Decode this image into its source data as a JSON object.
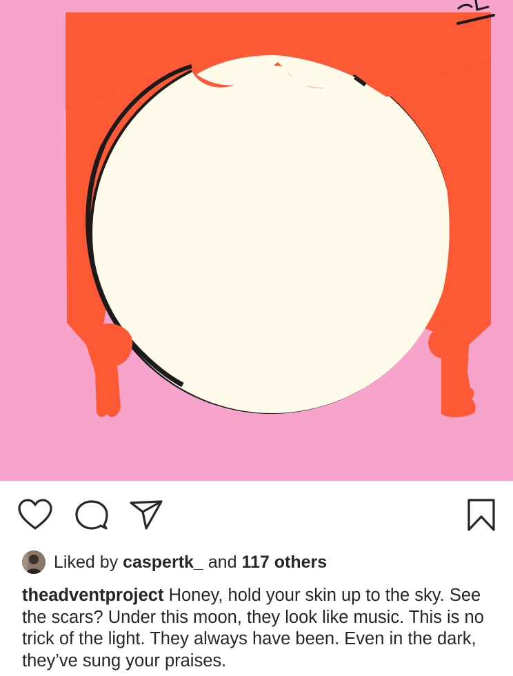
{
  "post": {
    "image": {
      "description_icon": "moon-curtain-illustration",
      "colors": {
        "background_pink": "#f7a3cb",
        "curtain_orange": "#fd5935",
        "moon_cream": "#fffbea",
        "shadow_arc": "#1b1b1b"
      },
      "corner_mark_icon": "handwritten-day-number-mark"
    },
    "actions": {
      "like_icon": "heart-icon",
      "comment_icon": "comment-bubble-icon",
      "share_icon": "paper-plane-icon",
      "save_icon": "bookmark-icon"
    },
    "likes": {
      "prefix": "Liked by",
      "liker": "caspertk_",
      "joiner": "and",
      "others": "117 others"
    },
    "caption": {
      "username": "theadventproject",
      "text": "Honey, hold your skin up to the sky. See the scars? Under this moon, they look like music. This is no trick of the light. They always have been. Even in the dark, they’ve sung your praises."
    }
  }
}
